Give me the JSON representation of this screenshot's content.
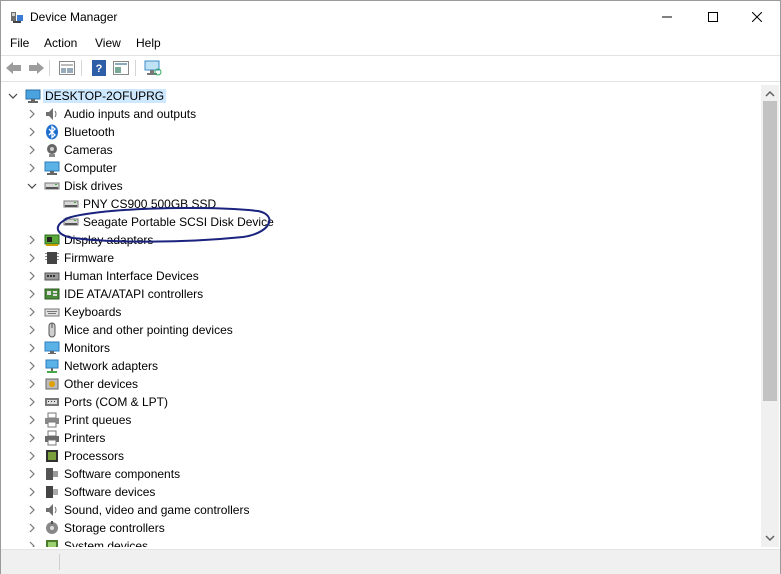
{
  "window": {
    "title": "Device Manager"
  },
  "menu": [
    "File",
    "Action",
    "View",
    "Help"
  ],
  "toolbar": {
    "buttons": [
      "back-icon",
      "forward-icon",
      "properties-icon",
      "help-icon",
      "show-hidden-icon",
      "scan-hardware-icon"
    ]
  },
  "tree": {
    "root": "DESKTOP-2OFUPRG",
    "categories": [
      {
        "label": "Audio inputs and outputs",
        "icon": "speaker-icon",
        "expanded": false
      },
      {
        "label": "Bluetooth",
        "icon": "bluetooth-icon",
        "expanded": false
      },
      {
        "label": "Cameras",
        "icon": "camera-icon",
        "expanded": false
      },
      {
        "label": "Computer",
        "icon": "computer-icon",
        "expanded": false
      },
      {
        "label": "Disk drives",
        "icon": "disk-drive-icon",
        "expanded": true,
        "children": [
          "PNY CS900 500GB SSD",
          "Seagate Portable SCSI Disk Device"
        ]
      },
      {
        "label": "Display adapters",
        "icon": "display-adapter-icon",
        "expanded": false
      },
      {
        "label": "Firmware",
        "icon": "firmware-icon",
        "expanded": false
      },
      {
        "label": "Human Interface Devices",
        "icon": "hid-icon",
        "expanded": false
      },
      {
        "label": "IDE ATA/ATAPI controllers",
        "icon": "ide-controller-icon",
        "expanded": false
      },
      {
        "label": "Keyboards",
        "icon": "keyboard-icon",
        "expanded": false
      },
      {
        "label": "Mice and other pointing devices",
        "icon": "mouse-icon",
        "expanded": false
      },
      {
        "label": "Monitors",
        "icon": "monitor-icon",
        "expanded": false
      },
      {
        "label": "Network adapters",
        "icon": "network-icon",
        "expanded": false
      },
      {
        "label": "Other devices",
        "icon": "other-device-icon",
        "expanded": false
      },
      {
        "label": "Ports (COM & LPT)",
        "icon": "port-icon",
        "expanded": false
      },
      {
        "label": "Print queues",
        "icon": "print-queue-icon",
        "expanded": false
      },
      {
        "label": "Printers",
        "icon": "printer-icon",
        "expanded": false
      },
      {
        "label": "Processors",
        "icon": "processor-icon",
        "expanded": false
      },
      {
        "label": "Software components",
        "icon": "software-component-icon",
        "expanded": false
      },
      {
        "label": "Software devices",
        "icon": "software-device-icon",
        "expanded": false
      },
      {
        "label": "Sound, video and game controllers",
        "icon": "speaker-icon",
        "expanded": false
      },
      {
        "label": "Storage controllers",
        "icon": "storage-controller-icon",
        "expanded": false
      },
      {
        "label": "System devices",
        "icon": "system-device-icon",
        "expanded": false
      }
    ]
  },
  "annotation": {
    "color": "#1a237e",
    "target": "Seagate Portable SCSI Disk Device"
  }
}
